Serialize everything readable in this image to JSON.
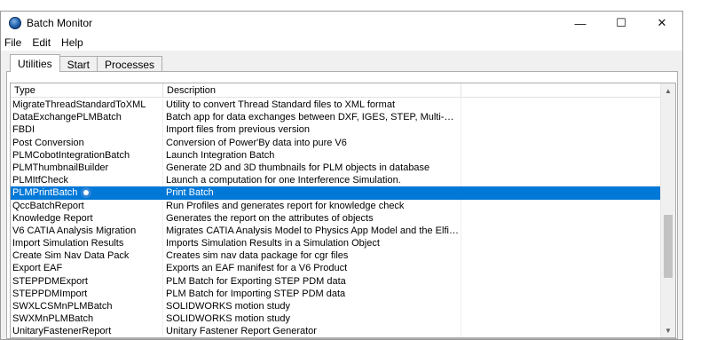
{
  "window": {
    "title": "Batch Monitor",
    "minimize_glyph": "—",
    "maximize_glyph": "☐",
    "close_glyph": "✕"
  },
  "menu": [
    {
      "label": "File"
    },
    {
      "label": "Edit"
    },
    {
      "label": "Help"
    }
  ],
  "tabs": [
    {
      "label": "Utilities",
      "active": true
    },
    {
      "label": "Start",
      "active": false
    },
    {
      "label": "Processes",
      "active": false
    }
  ],
  "table": {
    "columns": [
      "Type",
      "Description"
    ],
    "rows": [
      {
        "type": "MigrateThreadStandardToXML",
        "description": "Utility to convert Thread Standard files to XML format"
      },
      {
        "type": "DataExchangePLMBatch",
        "description": "Batch app for data exchanges between DXF, IGES, STEP, Multi-CAD, ICEM formats an..."
      },
      {
        "type": "FBDI",
        "description": "Import files from previous version"
      },
      {
        "type": "Post Conversion",
        "description": "Conversion of Power'By data into pure V6"
      },
      {
        "type": "PLMCobotIntegrationBatch",
        "description": "Launch Integration Batch"
      },
      {
        "type": "PLMThumbnailBuilder",
        "description": "Generate 2D and 3D thumbnails for PLM objects in database"
      },
      {
        "type": "PLMItfCheck",
        "description": "Launch a computation for one Interference Simulation."
      },
      {
        "type": "PLMPrintBatch",
        "description": "Print Batch",
        "selected": true
      },
      {
        "type": "QccBatchReport",
        "description": "Run Profiles and generates report for knowledge check"
      },
      {
        "type": "Knowledge Report",
        "description": "Generates the report on the attributes of objects"
      },
      {
        "type": "V6 CATIA Analysis Migration",
        "description": "Migrates CATIA Analysis Model to Physics App Model and the Elfini domain of mate..."
      },
      {
        "type": "Import Simulation Results",
        "description": "Imports Simulation Results in a Simulation Object"
      },
      {
        "type": "Create Sim Nav Data Pack",
        "description": "Creates sim nav data package for cgr files"
      },
      {
        "type": "Export EAF",
        "description": "Exports an EAF manifest for a V6 Product"
      },
      {
        "type": "STEPPDMExport",
        "description": "PLM Batch for Exporting STEP PDM data"
      },
      {
        "type": "STEPPDMImport",
        "description": "PLM Batch for Importing STEP PDM data"
      },
      {
        "type": "SWXLCSMnPLMBatch",
        "description": "SOLIDWORKS motion study"
      },
      {
        "type": "SWXMnPLMBatch",
        "description": "SOLIDWORKS motion study"
      },
      {
        "type": "UnitaryFastenerReport",
        "description": "Unitary Fastener Report Generator"
      }
    ]
  },
  "scrollbar": {
    "up_glyph": "▲",
    "down_glyph": "▼",
    "position_fraction": 0.72,
    "visible_fraction": 0.28
  },
  "colors": {
    "selection": "#0078d7",
    "title_icon": "#1e5ea8"
  }
}
